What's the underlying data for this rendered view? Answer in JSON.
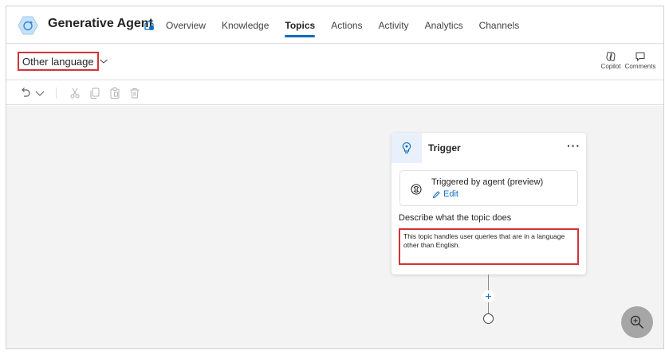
{
  "header": {
    "agent_name": "Generative Agent",
    "tabs": [
      {
        "label": "Overview"
      },
      {
        "label": "Knowledge"
      },
      {
        "label": "Topics",
        "active": true
      },
      {
        "label": "Actions"
      },
      {
        "label": "Activity"
      },
      {
        "label": "Analytics"
      },
      {
        "label": "Channels"
      }
    ]
  },
  "topic": {
    "name": "Other language",
    "copilot_label": "Copilot",
    "comments_label": "Comments"
  },
  "toolbar": {
    "icons": [
      "undo-icon",
      "chevron-down-icon",
      "cut-icon",
      "copy-icon",
      "paste-icon",
      "delete-icon"
    ]
  },
  "trigger_node": {
    "title": "Trigger",
    "more": "···",
    "trigger_label": "Triggered by agent (preview)",
    "edit_label": "Edit",
    "description_label": "Describe what the topic does",
    "description_value": "This topic handles user queries that are in a language other than English."
  },
  "canvas": {
    "add_label": "+"
  },
  "colors": {
    "accent": "#0f6cbd",
    "highlight": "#d13438",
    "canvas": "#f3f3f3"
  }
}
